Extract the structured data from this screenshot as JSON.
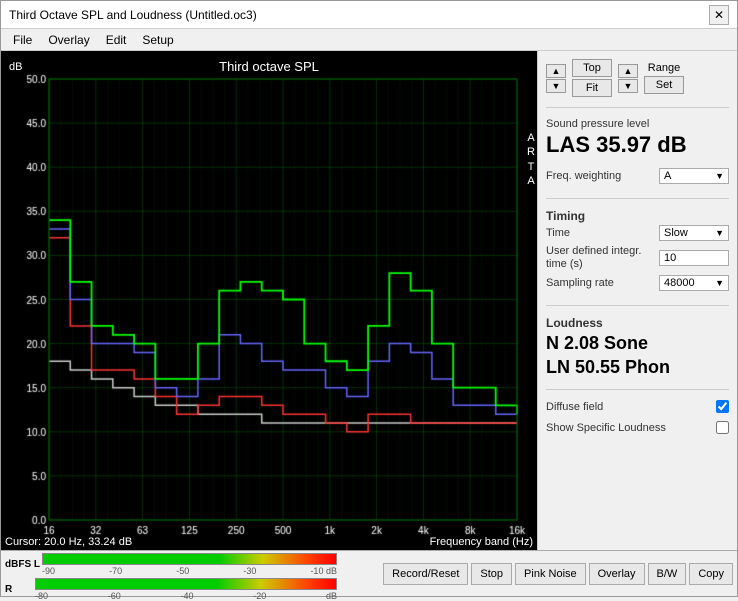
{
  "window": {
    "title": "Third Octave SPL and Loudness (Untitled.oc3)",
    "close_btn": "✕"
  },
  "menu": {
    "items": [
      "File",
      "Overlay",
      "Edit",
      "Setup"
    ]
  },
  "chart": {
    "title": "Third octave SPL",
    "db_label": "dB",
    "arta_label": "A\nR\nT\nA",
    "y_axis": [
      "50.0",
      "45.0",
      "40.0",
      "35.0",
      "30.0",
      "25.0",
      "20.0",
      "15.0",
      "10.0",
      "5.0"
    ],
    "x_axis": [
      "16",
      "32",
      "63",
      "125",
      "250",
      "500",
      "1k",
      "2k",
      "4k",
      "8k",
      "16k"
    ],
    "cursor_text": "Cursor:  20.0 Hz, 33.24 dB",
    "freq_band_text": "Frequency band (Hz)"
  },
  "right_panel": {
    "top_btn": "Top",
    "fit_btn": "Fit",
    "range_label": "Range",
    "set_btn": "Set",
    "spl_section": {
      "label": "Sound pressure level",
      "value": "LAS 35.97 dB"
    },
    "freq_weighting": {
      "label": "Freq. weighting",
      "value": "A"
    },
    "timing": {
      "title": "Timing",
      "time_label": "Time",
      "time_value": "Slow",
      "user_defined_label": "User defined integr. time (s)",
      "user_defined_value": "10",
      "sampling_rate_label": "Sampling rate",
      "sampling_rate_value": "48000"
    },
    "loudness": {
      "title": "Loudness",
      "n_value": "N 2.08 Sone",
      "ln_value": "LN 50.55 Phon"
    },
    "diffuse_field": {
      "label": "Diffuse field",
      "checked": true
    },
    "show_specific": {
      "label": "Show Specific Loudness",
      "checked": false
    }
  },
  "bottom_bar": {
    "dbfs_label": "dBFS",
    "l_label": "L",
    "r_label": "R",
    "l_markers": [
      "-90",
      "-70",
      "-50",
      "-30",
      "-10 dB"
    ],
    "r_markers": [
      "-80",
      "-60",
      "-40",
      "-20",
      "dB"
    ],
    "buttons": [
      "Record/Reset",
      "Stop",
      "Pink Noise",
      "Overlay",
      "B/W",
      "Copy"
    ]
  }
}
